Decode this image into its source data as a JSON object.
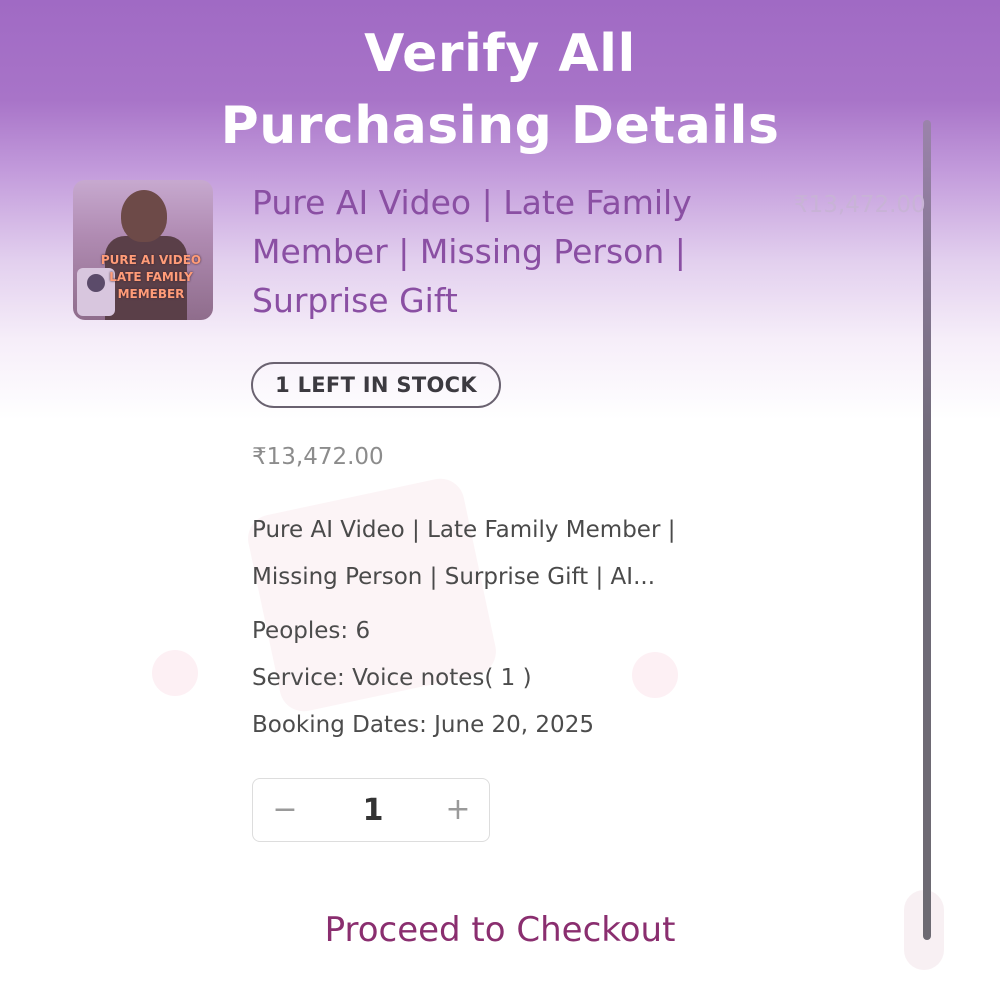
{
  "headline": {
    "line1": "Verify All",
    "line2": "Purchasing Details"
  },
  "product": {
    "thumbnail_text": [
      "PURE AI VIDEO",
      "LATE FAMILY",
      "MEMEBER"
    ],
    "title_lines": [
      "Pure AI Video | Late Family",
      "Member | Missing Person |",
      "Surprise Gift"
    ],
    "price_side": "₹13,472.00",
    "stock_badge": "1 LEFT IN STOCK",
    "price": "₹13,472.00",
    "description_lines": [
      "Pure AI Video | Late Family Member |",
      "Missing Person | Surprise Gift | AI..."
    ],
    "peoples": "Peoples: 6",
    "service": "Service: Voice notes( 1 )",
    "booking_dates": "Booking Dates: June 20, 2025"
  },
  "quantity": {
    "minus": "−",
    "value": "1",
    "plus": "+"
  },
  "checkout": {
    "label": "Proceed to Checkout"
  },
  "colors": {
    "header_purple": "#a06ac4",
    "title_purple": "#8a4fa3",
    "checkout_magenta": "#8a2e6f"
  }
}
